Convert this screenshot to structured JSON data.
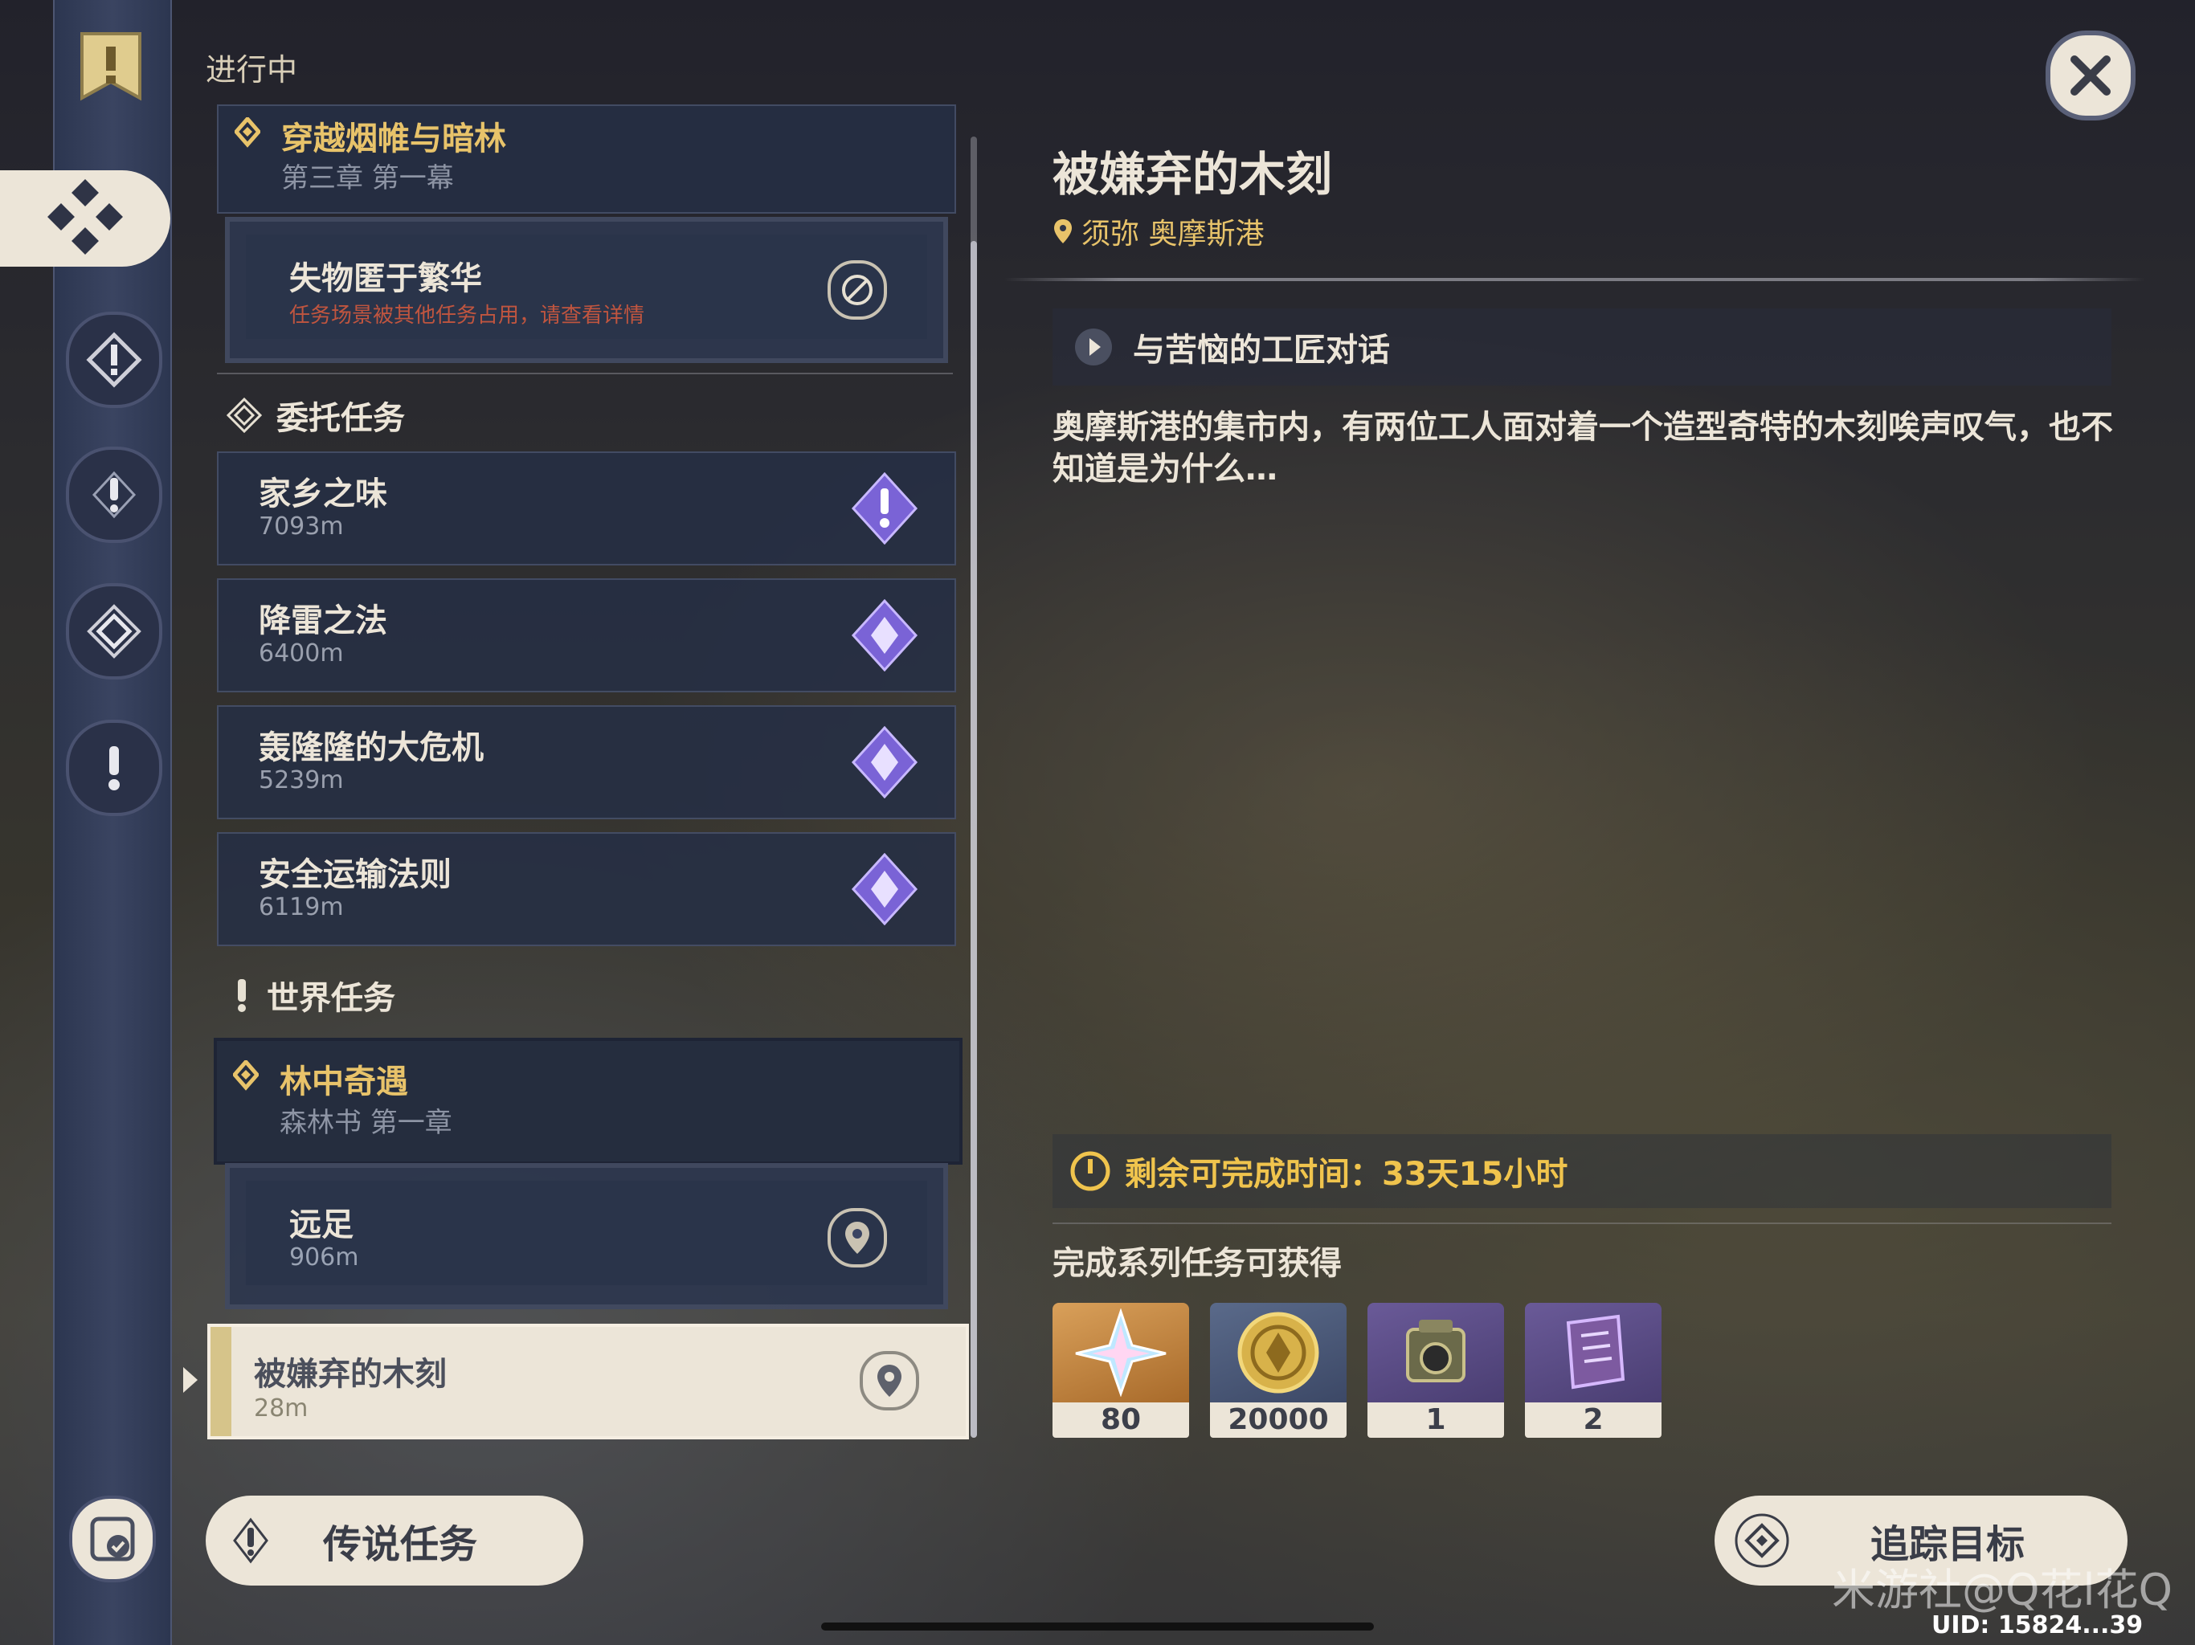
{
  "header": {
    "in_progress": "进行中"
  },
  "rail": {
    "items": [
      "quest-book-icon",
      "commission-tab-icon",
      "archon-quest-icon",
      "world-quest-icon",
      "commission-quest-icon",
      "alert-quest-icon",
      "settings-check-icon"
    ]
  },
  "archon_quest": {
    "title": "穿越烟帷与暗林",
    "subtitle": "第三章 第一幕",
    "step": {
      "title": "失物匿于繁华",
      "note": "任务场景被其他任务占用，请查看详情",
      "note_color": "#c0553f"
    }
  },
  "commissions": {
    "header": "委托任务",
    "items": [
      {
        "title": "家乡之味",
        "distance": "7093m",
        "icon": "daily-alert-icon"
      },
      {
        "title": "降雷之法",
        "distance": "6400m",
        "icon": "daily-star-icon"
      },
      {
        "title": "轰隆隆的大危机",
        "distance": "5239m",
        "icon": "daily-star-icon"
      },
      {
        "title": "安全运输法则",
        "distance": "6119m",
        "icon": "daily-star-icon"
      }
    ]
  },
  "world_quests": {
    "header": "世界任务",
    "chapter": {
      "title": "林中奇遇",
      "subtitle": "森林书 第一章"
    },
    "step": {
      "title": "远足",
      "distance": "906m"
    },
    "selected": {
      "title": "被嫌弃的木刻",
      "distance": "28m"
    }
  },
  "detail": {
    "title": "被嫌弃的木刻",
    "location": "须弥 奥摩斯港",
    "objective": "与苦恼的工匠对话",
    "description": "奥摩斯港的集市内，有两位工人面对着一个造型奇特的木刻唉声叹气，也不知道是为什么…",
    "timer": "剩余可完成时间：33天15小时",
    "rewards_label": "完成系列任务可获得",
    "rewards": [
      {
        "name": "primogem",
        "count": "80",
        "bg": "#c98a3a"
      },
      {
        "name": "mora",
        "count": "20000",
        "bg": "#4a5a78"
      },
      {
        "name": "adventure-exp-camera",
        "count": "1",
        "bg": "#5a4e80"
      },
      {
        "name": "heros-wit-book",
        "count": "2",
        "bg": "#5a4e80"
      }
    ]
  },
  "buttons": {
    "legend_quests": "传说任务",
    "track": "追踪目标"
  },
  "watermark": "米游社@Q花l花Q",
  "uid": "UID: 15824...39"
}
